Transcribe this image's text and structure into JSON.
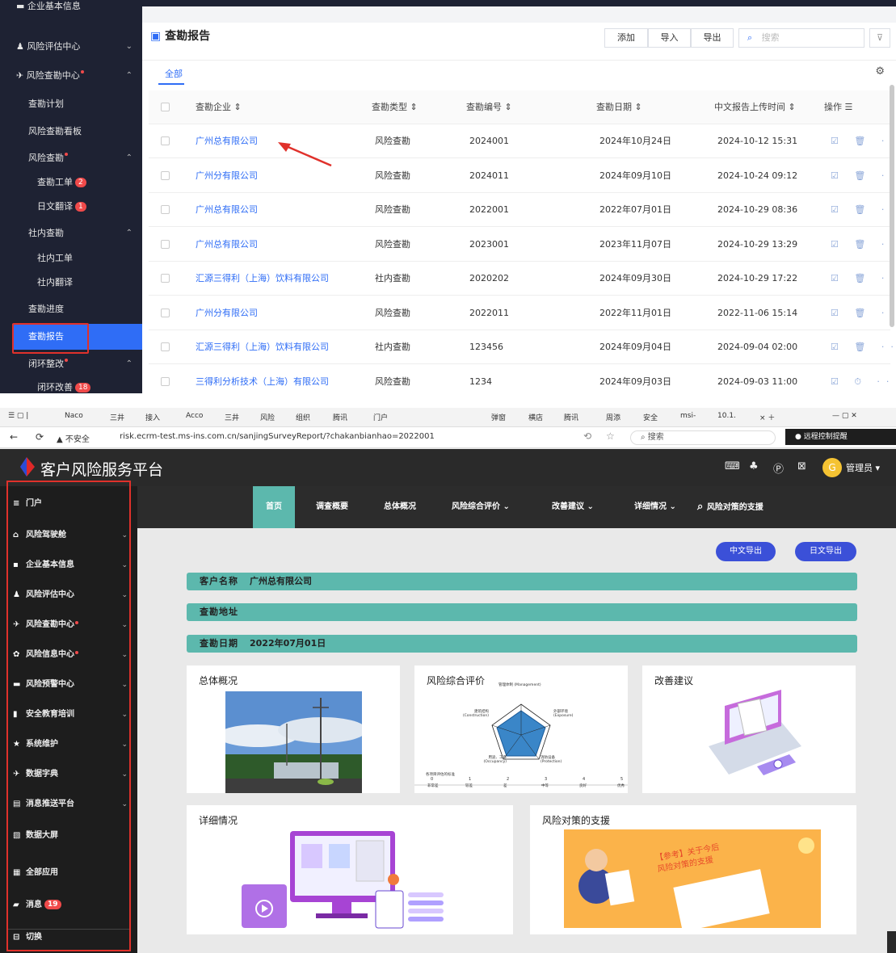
{
  "top": {
    "header_partial": "客户风险服务平台",
    "sidebar": [
      {
        "label": "企业基本信息",
        "clip": true
      },
      {
        "label": "风险评估中心",
        "chevron": "down"
      },
      {
        "label": "风险查勘中心",
        "dot": true,
        "chevron": "up"
      },
      {
        "label": "查勘计划"
      },
      {
        "label": "风险查勘看板"
      },
      {
        "label": "风险查勘",
        "dot": true,
        "chevron": "up"
      },
      {
        "label": "查勘工单",
        "badge": "2"
      },
      {
        "label": "日文翻译",
        "badge": "1"
      },
      {
        "label": "社内查勘",
        "chevron": "up"
      },
      {
        "label": "社内工单"
      },
      {
        "label": "社内翻译"
      },
      {
        "label": "查勘进度"
      },
      {
        "label": "查勘报告",
        "active": true
      },
      {
        "label": "闭环整改",
        "dot": true,
        "chevron": "up"
      },
      {
        "label": "闭环改善",
        "badge": "18"
      }
    ],
    "page_title": "查勘报告",
    "toolbar": {
      "add": "添加",
      "import": "导入",
      "export": "导出",
      "search_placeholder": "搜索"
    },
    "tab_all": "全部",
    "table": {
      "headers": [
        "查勘企业 ⇕",
        "查勘类型 ⇕",
        "查勘编号 ⇕",
        "查勘日期 ⇕",
        "中文报告上传时间 ⇕",
        "操作 ☰"
      ],
      "rows": [
        [
          "广州总有限公司",
          "风险查勘",
          "2024001",
          "2024年10月24日",
          "2024-10-12 15:31"
        ],
        [
          "广州分有限公司",
          "风险查勘",
          "2024011",
          "2024年09月10日",
          "2024-10-24 09:12"
        ],
        [
          "广州总有限公司",
          "风险查勘",
          "2022001",
          "2022年07月01日",
          "2024-10-29 08:36"
        ],
        [
          "广州总有限公司",
          "风险查勘",
          "2023001",
          "2023年11月07日",
          "2024-10-29 13:29"
        ],
        [
          "汇源三得利（上海）饮料有限公司",
          "社内查勘",
          "2020202",
          "2024年09月30日",
          "2024-10-29 17:22"
        ],
        [
          "广州分有限公司",
          "风险查勘",
          "2022011",
          "2022年11月01日",
          "2022-11-06 15:14"
        ],
        [
          "汇源三得利（上海）饮料有限公司",
          "社内查勘",
          "123456",
          "2024年09月04日",
          "2024-09-04 02:00"
        ],
        [
          "三得利分析技术（上海）有限公司",
          "风险查勘",
          "1234",
          "2024年09月03日",
          "2024-09-03 11:00"
        ]
      ],
      "ops": [
        "☑ 🗑 ···",
        "☑ ⏱ ···"
      ]
    }
  },
  "bottom": {
    "browser_tabs": [
      "Naco",
      "三井",
      "接入",
      "Acco",
      "三井",
      "风险",
      "组织",
      "腾讯",
      "门户",
      "弹窗",
      "横店",
      "腾讯",
      "周添",
      "安全",
      "msi-",
      "10.1."
    ],
    "insecure": "▲ 不安全",
    "url": "risk.ecrm-test.ms-ins.com.cn/sanjingSurveyReport/?chakanbianhao=2022001",
    "search": "搜索",
    "remote": "远程控制提醒",
    "app_title": "客户风险服务平台",
    "user": "管理员 ▾",
    "avatar_letter": "G",
    "sidebar": [
      {
        "label": "门户",
        "icon": "≡",
        "chevron": false
      },
      {
        "label": "风险驾驶舱",
        "icon": "⌂",
        "chevron": true
      },
      {
        "label": "企业基本信息",
        "icon": "▪",
        "chevron": true
      },
      {
        "label": "风险评估中心",
        "icon": "♟",
        "chevron": true
      },
      {
        "label": "风险查勘中心",
        "icon": "✈",
        "chevron": true,
        "dot": true
      },
      {
        "label": "风险信息中心",
        "icon": "✿",
        "chevron": true,
        "dot": true
      },
      {
        "label": "风险预警中心",
        "icon": "▬",
        "chevron": true
      },
      {
        "label": "安全教育培训",
        "icon": "▮",
        "chevron": true
      },
      {
        "label": "系统维护",
        "icon": "★",
        "chevron": true
      },
      {
        "label": "数据字典",
        "icon": "✈",
        "chevron": true
      },
      {
        "label": "消息推送平台",
        "icon": "▤",
        "chevron": true
      },
      {
        "label": "数据大屏",
        "icon": "▧",
        "chevron": false
      },
      {
        "label": "全部应用",
        "icon": "▦",
        "chevron": false
      },
      {
        "label": "消息",
        "icon": "▰",
        "chevron": false,
        "badge": "19"
      },
      {
        "label": "切换",
        "icon": "⊟",
        "chevron": false
      }
    ],
    "nav": [
      "首页",
      "调查概要",
      "总体概况",
      "风险综合评价 ⌄",
      "改善建议 ⌄",
      "详细情况 ⌄",
      "风险对策的支援"
    ],
    "export_cn": "中文导出",
    "export_jp": "日文导出",
    "bars": [
      {
        "label": "客户名称",
        "value": "广州总有限公司"
      },
      {
        "label": "查勘地址",
        "value": ""
      },
      {
        "label": "查勘日期",
        "value": "2022年07月01日"
      }
    ],
    "cards": {
      "overview": "总体概况",
      "evaluation": "风险综合评价",
      "suggestion": "改善建议",
      "detail": "详细情况",
      "support": "风险对策的支援",
      "support_banner": "【参考】关于今后风险对策的支援"
    },
    "radar": {
      "axes": [
        "管理体制 (Management)",
        "外部环境 (Exposure)",
        "消防设备 (Protection)",
        "用途、工序 (Occupancy)",
        "建筑结构 (Construction)"
      ],
      "scale_title": "各项目评估的标准",
      "scale_nums": [
        "0",
        "1",
        "2",
        "3",
        "4",
        "5"
      ],
      "scale_words": [
        "非常差",
        "较差",
        "差",
        "中等",
        "良好",
        "优秀"
      ]
    }
  }
}
